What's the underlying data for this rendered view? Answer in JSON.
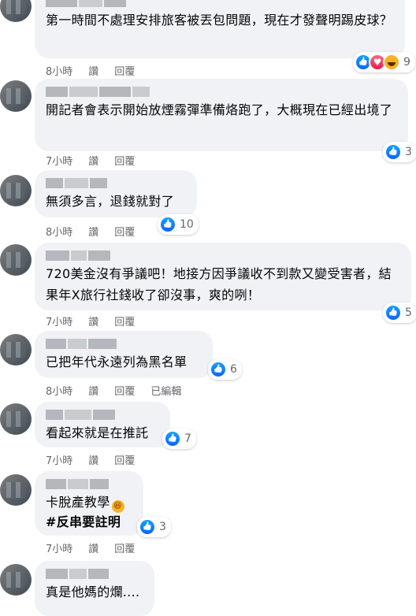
{
  "comments": [
    {
      "text": "第一時間不處理安排旅客被丟包問題，現在才發聲明踢皮球？",
      "time": "8小時",
      "reply_label": "讚",
      "respond_label": "回覆",
      "reactions": [
        "like",
        "love",
        "haha"
      ],
      "count": "9"
    },
    {
      "text": "開記者會表示開始放煙霧彈準備烙跑了，大概現在已經出境了",
      "time": "7小時",
      "reply_label": "讚",
      "respond_label": "回覆",
      "reactions": [
        "like"
      ],
      "count": "3"
    },
    {
      "text": "無須多言，退錢就對了",
      "time": "8小時",
      "reply_label": "讚",
      "respond_label": "回覆",
      "reactions": [
        "like"
      ],
      "count": "10"
    },
    {
      "text": "720美金沒有爭議吧！地接方因爭議收不到款又變受害者，結果年X旅行社錢收了卻沒事，爽的咧！",
      "time": "7小時",
      "reply_label": "讚",
      "respond_label": "回覆",
      "reactions": [
        "like"
      ],
      "count": "5"
    },
    {
      "text": "已把年代永遠列為黑名單",
      "time": "8小時",
      "reply_label": "讚",
      "respond_label": "回覆",
      "edited_label": "已編輯",
      "reactions": [
        "like"
      ],
      "count": "6"
    },
    {
      "text": "看起來就是在推託",
      "time": "7小時",
      "reply_label": "讚",
      "respond_label": "回覆",
      "reactions": [
        "like"
      ],
      "count": "7"
    },
    {
      "text": "卡脫產教學",
      "text2": "#反串要註明",
      "time": "7小時",
      "reply_label": "讚",
      "respond_label": "回覆",
      "reactions": [
        "like"
      ],
      "count": "3"
    },
    {
      "text": "真是他媽的爛....",
      "time": "",
      "reply_label": "",
      "respond_label": "",
      "reactions": [],
      "count": ""
    }
  ],
  "colors": {
    "bubble": "#f0f2f5",
    "meta": "#65676b",
    "like": "#0866ff"
  }
}
